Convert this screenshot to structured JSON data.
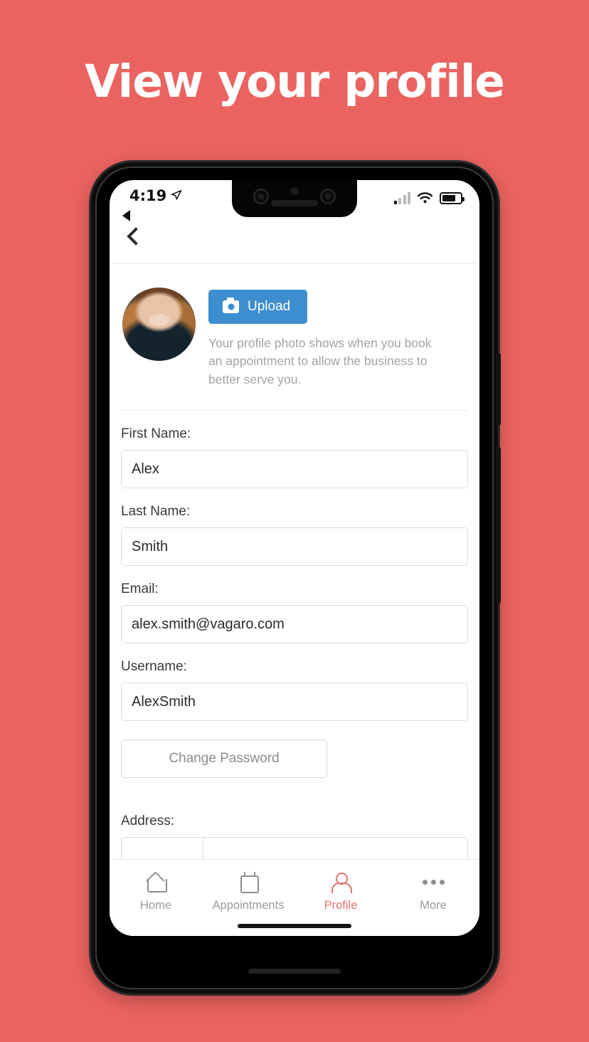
{
  "page": {
    "headline": "View your profile",
    "background_color": "#ea6360"
  },
  "status_bar": {
    "time": "4:19",
    "location_icon": "location-arrow-icon",
    "signal_icon": "cellular-signal-icon",
    "wifi_icon": "wifi-icon",
    "battery_icon": "battery-icon",
    "back_indicator": "back-triangle-icon"
  },
  "nav": {
    "back_icon": "chevron-left-icon"
  },
  "photo_section": {
    "avatar_alt": "profile-photo",
    "upload_label": "Upload",
    "upload_icon": "camera-icon",
    "upload_color": "#3d8ecf",
    "helper_text": "Your profile photo shows when you book an appointment to allow the business to better serve you."
  },
  "form": {
    "fields": [
      {
        "label": "First Name:",
        "value": "Alex"
      },
      {
        "label": "Last Name:",
        "value": "Smith"
      },
      {
        "label": "Email:",
        "value": "alex.smith@vagaro.com"
      },
      {
        "label": "Username:",
        "value": "AlexSmith"
      }
    ],
    "change_password_label": "Change Password",
    "address_label": "Address:"
  },
  "tabbar": {
    "active_color": "#e4736e",
    "inactive_color": "#9b9b9b",
    "items": [
      {
        "label": "Home",
        "icon": "home-icon"
      },
      {
        "label": "Appointments",
        "icon": "calendar-icon"
      },
      {
        "label": "Profile",
        "icon": "person-icon"
      },
      {
        "label": "More",
        "icon": "more-dots-icon"
      }
    ]
  }
}
